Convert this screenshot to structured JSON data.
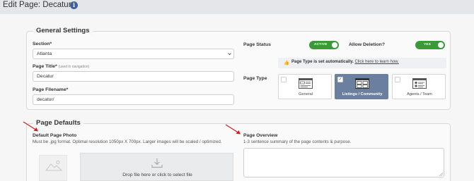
{
  "header": {
    "title": "Edit Page: Decatur",
    "info_icon": "info-icon"
  },
  "general_settings": {
    "legend": "General Settings",
    "section": {
      "label": "Section*",
      "value": "Atlanta"
    },
    "page_title": {
      "label": "Page Title*",
      "hint": "(used in navigation)",
      "value": "Decatur"
    },
    "page_filename": {
      "label": "Page Filename*",
      "value": "decatur/"
    },
    "page_status": {
      "label": "Page Status",
      "toggle_text": "ACTIVE",
      "on": true
    },
    "allow_deletion": {
      "label": "Allow Deletion?",
      "toggle_text": "YES",
      "on": true
    },
    "notice": {
      "bold": "Page Type is set automatically.",
      "link": "Click here to learn how."
    },
    "page_type": {
      "label": "Page Type",
      "options": [
        {
          "name": "General",
          "selected": false
        },
        {
          "name": "Listings / Community",
          "selected": true
        },
        {
          "name": "Agents / Team",
          "selected": false
        }
      ]
    }
  },
  "page_defaults": {
    "legend": "Page Defaults",
    "photo": {
      "label": "Default Page Photo",
      "help": "Must be .jpg format. Optimal resolution 1050px X 700px. Larger images will be scaled / optimized.",
      "dropzone_text": "Drop file here or click to select file"
    },
    "overview": {
      "label": "Page Overview",
      "help": "1-3 sentence summary of the page contents & purpose.",
      "value": ""
    }
  },
  "colors": {
    "toggle_on": "#3a9a3a",
    "selected_card": "#6b7fa0",
    "info": "#3d5fa3",
    "arrow": "#d42020"
  }
}
